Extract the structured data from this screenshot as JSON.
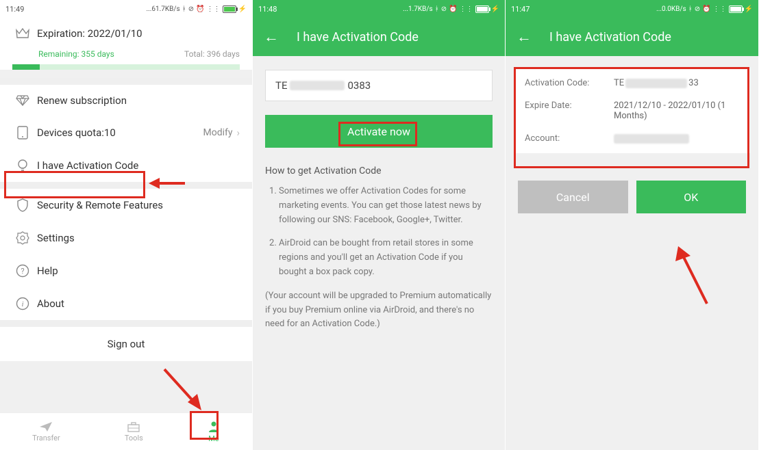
{
  "screen1": {
    "status": {
      "time": "11:49",
      "net": "...61.7KB/s"
    },
    "expiration_label": "Expiration: 2022/01/10",
    "remaining": "Remaining: 355 days",
    "total_days": "Total: 396 days",
    "renew": "Renew subscription",
    "devices": "Devices quota:10",
    "modify": "Modify",
    "activation": "I have Activation Code",
    "security": "Security & Remote Features",
    "settings": "Settings",
    "help": "Help",
    "about": "About",
    "signout": "Sign out",
    "nav": {
      "transfer": "Transfer",
      "tools": "Tools",
      "me": "Me"
    }
  },
  "screen2": {
    "status": {
      "time": "11:48",
      "net": "...1.7KB/s"
    },
    "title": "I have Activation Code",
    "code_prefix": "TE",
    "code_suffix": "0383",
    "activate_btn": "Activate now",
    "howto_title": "How to get Activation Code",
    "howto_1": "Sometimes we offer Activation Codes for some marketing events. You can get those latest news by following our SNS: Facebook, Google+, Twitter.",
    "howto_2": "AirDroid can be bought from retail stores in some regions and you'll get an Activation Code if you bought a box pack copy.",
    "howto_note": "(Your account will be upgraded to Premium automatically if you buy Premium online via AirDroid, and there's no need for an Activation Code.)"
  },
  "screen3": {
    "status": {
      "time": "11:47",
      "net": "...0.0KB/s"
    },
    "title": "I have Activation Code",
    "act_label": "Activation Code:",
    "act_prefix": "TE",
    "act_suffix": "33",
    "exp_label": "Expire Date:",
    "exp_value": "2021/12/10 - 2022/01/10 (1 Months)",
    "acc_label": "Account:",
    "cancel": "Cancel",
    "ok": "OK"
  }
}
